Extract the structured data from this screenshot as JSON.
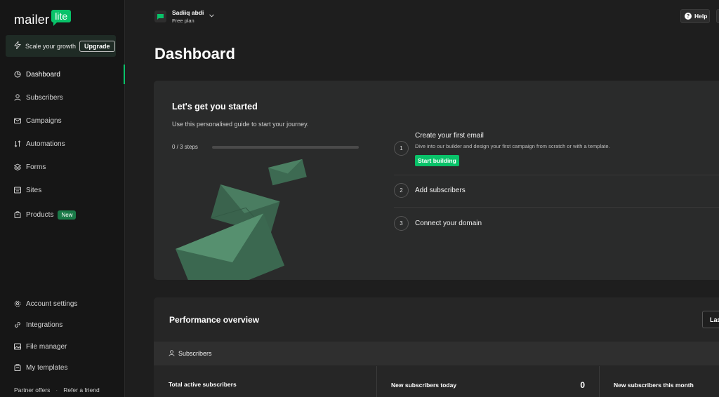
{
  "brand": {
    "name": "mailer",
    "badge": "lite"
  },
  "upgrade": {
    "text": "Scale your growth",
    "button": "Upgrade"
  },
  "sidebar": {
    "items": [
      {
        "label": "Dashboard",
        "icon": "dashboard-icon"
      },
      {
        "label": "Subscribers",
        "icon": "user-icon"
      },
      {
        "label": "Campaigns",
        "icon": "mail-icon"
      },
      {
        "label": "Automations",
        "icon": "automation-icon"
      },
      {
        "label": "Forms",
        "icon": "layers-icon"
      },
      {
        "label": "Sites",
        "icon": "browser-icon"
      },
      {
        "label": "Products",
        "icon": "shopping-bag-icon",
        "tag": "New"
      }
    ],
    "bottom_items": [
      {
        "label": "Account settings",
        "icon": "gear-icon"
      },
      {
        "label": "Integrations",
        "icon": "link-icon"
      },
      {
        "label": "File manager",
        "icon": "image-icon"
      },
      {
        "label": "My templates",
        "icon": "template-icon"
      }
    ],
    "footer": {
      "partner": "Partner offers",
      "separator": "·",
      "refer": "Refer a friend"
    }
  },
  "account": {
    "name": "Sadiiq abdi",
    "plan": "Free plan"
  },
  "header": {
    "help": "Help"
  },
  "page": {
    "title": "Dashboard"
  },
  "getting_started": {
    "title": "Let's get you started",
    "subtitle": "Use this personalised guide to start your journey.",
    "steps_count": "0 / 3 steps",
    "progress": 0,
    "steps": [
      {
        "num": "1",
        "title": "Create your first email",
        "desc": "Dive into our builder and design your first campaign from scratch or with a template.",
        "button": "Start building"
      },
      {
        "num": "2",
        "title": "Add subscribers"
      },
      {
        "num": "3",
        "title": "Connect your domain"
      }
    ]
  },
  "performance": {
    "title": "Performance overview",
    "range_button": "Las",
    "tab": "Subscribers",
    "stats": [
      {
        "label": "Total active subscribers",
        "value": ""
      },
      {
        "label": "New subscribers today",
        "value": "0"
      },
      {
        "label": "New subscribers this month",
        "value": ""
      }
    ]
  },
  "colors": {
    "accent": "#09c269",
    "background": "#1e1e1e",
    "sidebar": "#161616",
    "card": "#2a2b2b"
  }
}
